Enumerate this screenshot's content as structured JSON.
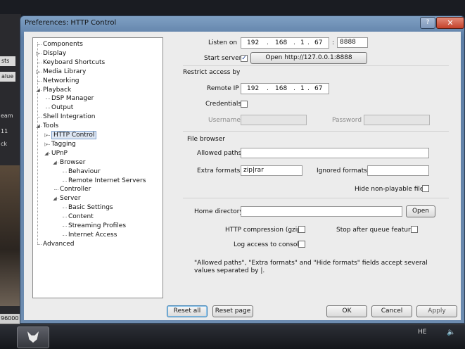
{
  "background": {
    "labels": [
      "sts",
      "alue"
    ],
    "side_text": [
      "eam",
      "11",
      "ck"
    ],
    "status": "96000"
  },
  "window": {
    "title": "Preferences: HTTP Control",
    "help": "?",
    "close": "✕"
  },
  "tree": [
    {
      "label": "Components",
      "indent": 0,
      "expander": "none"
    },
    {
      "label": "Display",
      "indent": 0,
      "expander": "closed"
    },
    {
      "label": "Keyboard Shortcuts",
      "indent": 0,
      "expander": "none"
    },
    {
      "label": "Media Library",
      "indent": 0,
      "expander": "closed"
    },
    {
      "label": "Networking",
      "indent": 0,
      "expander": "none"
    },
    {
      "label": "Playback",
      "indent": 0,
      "expander": "open"
    },
    {
      "label": "DSP Manager",
      "indent": 1,
      "expander": "none"
    },
    {
      "label": "Output",
      "indent": 1,
      "expander": "none"
    },
    {
      "label": "Shell Integration",
      "indent": 0,
      "expander": "none"
    },
    {
      "label": "Tools",
      "indent": 0,
      "expander": "open"
    },
    {
      "label": "HTTP Control",
      "indent": 1,
      "expander": "closed",
      "selected": true
    },
    {
      "label": "Tagging",
      "indent": 1,
      "expander": "closed"
    },
    {
      "label": "UPnP",
      "indent": 1,
      "expander": "open"
    },
    {
      "label": "Browser",
      "indent": 2,
      "expander": "open"
    },
    {
      "label": "Behaviour",
      "indent": 3,
      "expander": "none"
    },
    {
      "label": "Remote Internet Servers",
      "indent": 3,
      "expander": "none"
    },
    {
      "label": "Controller",
      "indent": 2,
      "expander": "none"
    },
    {
      "label": "Server",
      "indent": 2,
      "expander": "open"
    },
    {
      "label": "Basic Settings",
      "indent": 3,
      "expander": "none"
    },
    {
      "label": "Content",
      "indent": 3,
      "expander": "none"
    },
    {
      "label": "Streaming Profiles",
      "indent": 3,
      "expander": "none"
    },
    {
      "label": "Internet Access",
      "indent": 3,
      "expander": "none"
    },
    {
      "label": "Advanced",
      "indent": 0,
      "expander": "none"
    }
  ],
  "panel": {
    "listen_on_label": "Listen on",
    "listen_ip": [
      "192",
      "168",
      "1",
      "67"
    ],
    "port_sep": ":",
    "port": "8888",
    "start_server_label": "Start server",
    "start_server_checked": "✓",
    "open_button": "Open http://127.0.0.1:8888",
    "restrict_header": "Restrict access by",
    "remote_ip_label": "Remote IP",
    "remote_ip": [
      "192",
      "168",
      "1",
      "67"
    ],
    "credentials_label": "Credentials",
    "username_label": "Username",
    "password_label": "Password",
    "file_browser_header": "File browser",
    "allowed_paths_label": "Allowed paths",
    "extra_formats_label": "Extra formats",
    "extra_formats_value": "zip|rar",
    "ignored_formats_label": "Ignored formats",
    "hide_nonplayable_label": "Hide non-playable files",
    "home_directory_label": "Home directory",
    "open_label": "Open",
    "http_compression_label": "HTTP compression (gzip)",
    "stop_after_queue_label": "Stop after queue feature",
    "log_access_label": "Log access to console",
    "note": "\"Allowed paths\", \"Extra formats\" and \"Hide formats\" fields accept several values separated by |."
  },
  "buttons": {
    "reset_all": "Reset all",
    "reset_page": "Reset page",
    "ok": "OK",
    "cancel": "Cancel",
    "apply": "Apply"
  },
  "taskbar": {
    "language": "HE",
    "volume_icon": "speaker-icon"
  }
}
